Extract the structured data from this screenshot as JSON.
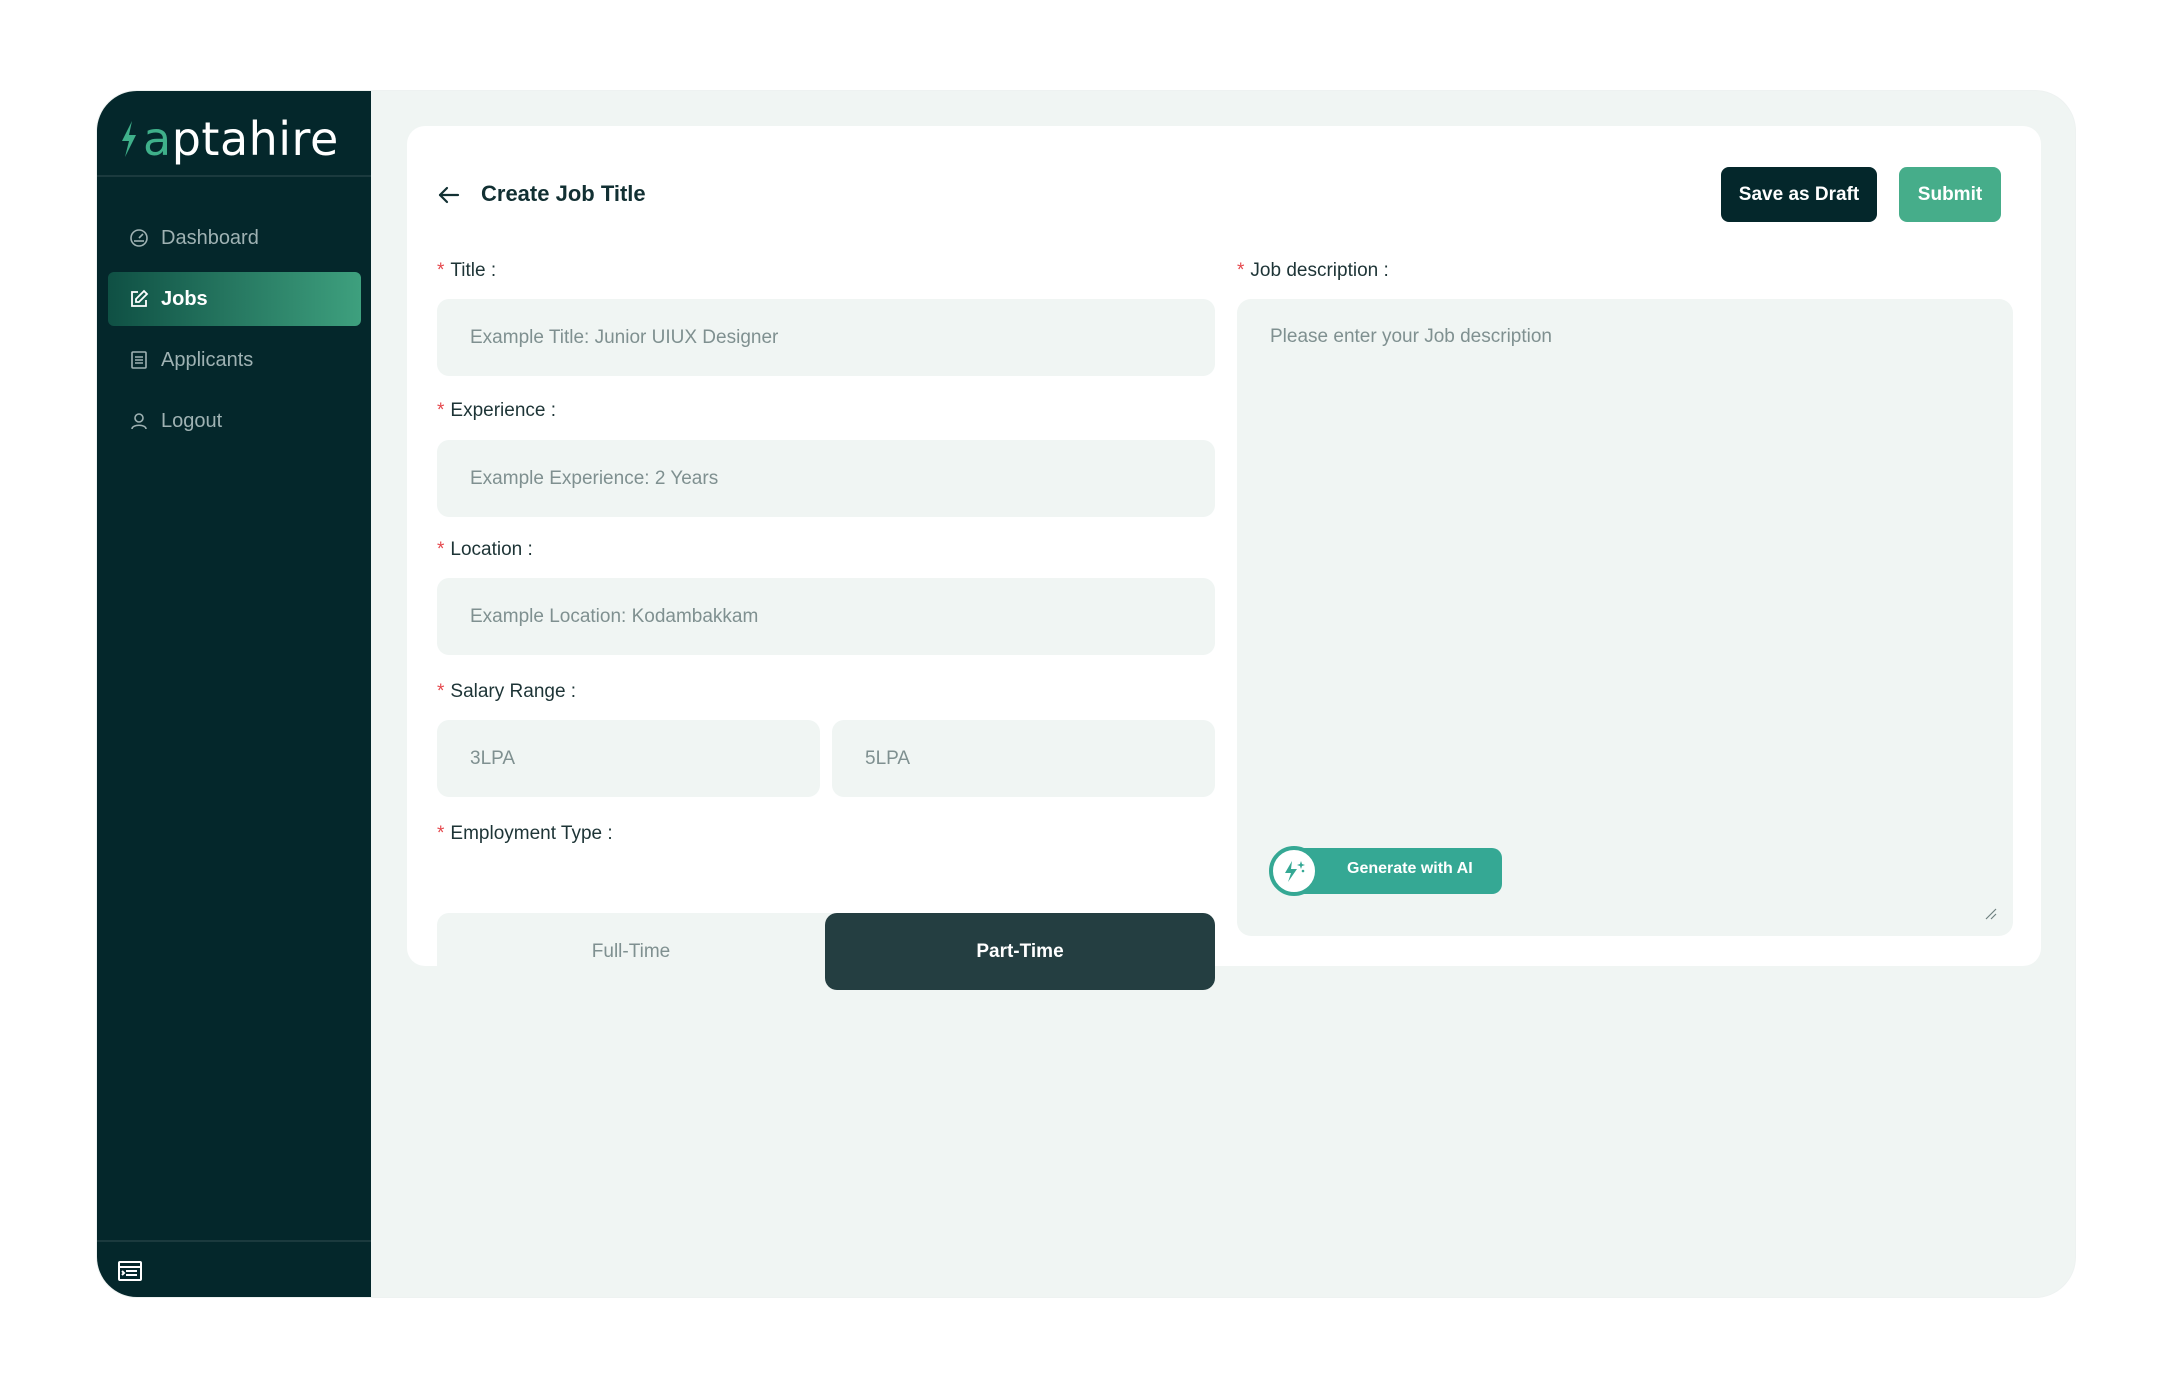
{
  "brand": {
    "prefix": "a",
    "name": "ptahire",
    "accent_color": "#3fb08a"
  },
  "sidebar": {
    "items": [
      {
        "label": "Dashboard",
        "icon": "gauge-icon",
        "active": false
      },
      {
        "label": "Jobs",
        "icon": "edit-icon",
        "active": true
      },
      {
        "label": "Applicants",
        "icon": "list-icon",
        "active": false
      },
      {
        "label": "Logout",
        "icon": "user-icon",
        "active": false
      }
    ],
    "collapse_icon": "sidebar-collapse-icon"
  },
  "header": {
    "title": "Create Job Title",
    "save_draft_label": "Save as Draft",
    "submit_label": "Submit"
  },
  "form": {
    "title": {
      "label": "Title :",
      "placeholder": "Example Title: Junior UIUX Designer",
      "value": ""
    },
    "experience": {
      "label": "Experience :",
      "placeholder": "Example Experience: 2 Years",
      "value": ""
    },
    "location": {
      "label": "Location :",
      "placeholder": "Example Location: Kodambakkam",
      "value": ""
    },
    "salary": {
      "label": "Salary Range :",
      "min_placeholder": "3LPA",
      "max_placeholder": "5LPA"
    },
    "employment_type": {
      "label": "Employment Type :",
      "options": [
        "Full-Time",
        "Part-Time"
      ],
      "selected": "Part-Time"
    },
    "job_description": {
      "label": "Job description :",
      "placeholder": "Please enter your Job description",
      "value": ""
    },
    "required_marker": "*",
    "ai_button_label": "Generate with AI"
  },
  "colors": {
    "sidebar_bg": "#04272b",
    "accent_green": "#46ad8a",
    "ai_teal": "#35a894",
    "selected_toggle": "#243e41"
  }
}
